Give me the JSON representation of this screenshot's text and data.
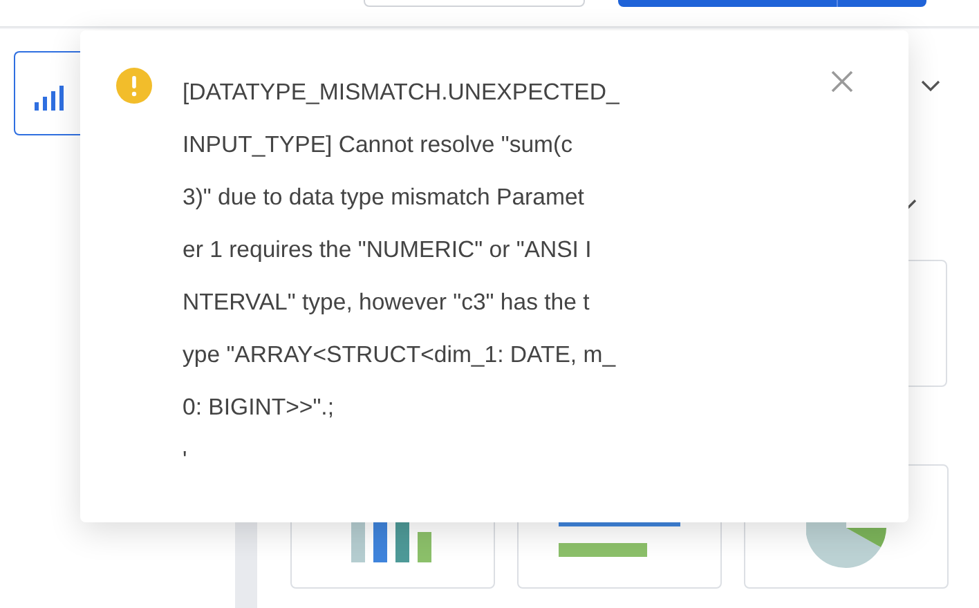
{
  "toast": {
    "kind": "warning",
    "lines": [
      "[DATATYPE_MISMATCH.UNEXPECTED_",
      "INPUT_TYPE] Cannot resolve \"sum(c",
      "3)\" due to data type mismatch Paramet",
      "er 1 requires the \"NUMERIC\" or \"ANSI I",
      "NTERVAL\" type, however \"c3\" has the t",
      "ype \"ARRAY<STRUCT<dim_1: DATE, m_",
      "0: BIGINT>>\".;",
      "'"
    ],
    "closable": true
  }
}
